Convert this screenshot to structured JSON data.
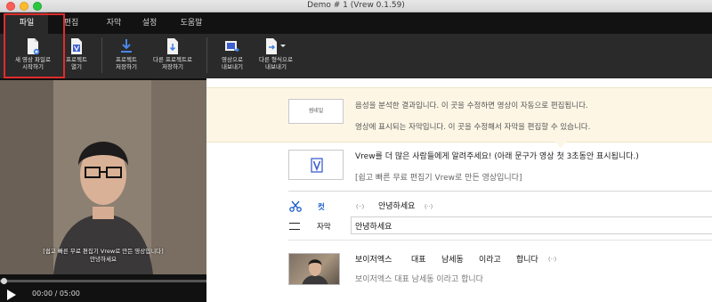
{
  "window": {
    "title": "Demo # 1 (Vrew 0.1.59)"
  },
  "menu": {
    "tabs": [
      {
        "label": "파일",
        "active": true
      },
      {
        "label": "편집",
        "active": false
      },
      {
        "label": "자막",
        "active": false
      },
      {
        "label": "설정",
        "active": false
      },
      {
        "label": "도움말",
        "active": false
      }
    ]
  },
  "toolbar": {
    "new_project": "새 영상 파일로\n시작하기",
    "open_project": "프로젝트\n열기",
    "save_project": "프로젝트\n저장하기",
    "save_as": "다른 프로젝트로\n저장하기",
    "export_video": "영상으로\n내보내기",
    "export_other": "다른 형식으로\n내보내기"
  },
  "player": {
    "subtitle_overlay_line1": "[쉽고 빠른 무료 편집기 Vrew로 만든 영상입니다]",
    "subtitle_overlay_line2": "안녕하세요",
    "time": "00:00 / 05:00",
    "progress": 0
  },
  "editor": {
    "info": {
      "thumb_label": "썸네일",
      "line1": "음성을 분석한 결과입니다. 이 곳을 수정하면 영상이 자동으로 편집됩니다.",
      "line2": "영상에 표시되는 자막입니다. 이 곳을 수정해서 자막을 편집할 수 있습니다."
    },
    "promo": {
      "line1": "Vrew를 더 많은 사람들에게 알려주세요! (아래 문구가 영상 첫 3초동안 표시됩니다.)",
      "line2": "[쉽고 빠른 무료 편집기 Vrew로 만든 영상입니다]"
    },
    "cut": {
      "label": "컷",
      "token_before": "(··)",
      "word": "안녕하세요",
      "token_after": "(··)"
    },
    "subtitle": {
      "label": "자막",
      "value": "안녕하세요"
    },
    "clip": {
      "words": [
        "보이저엑스",
        "대표",
        "남세동",
        "이라고",
        "합니다",
        "(··)"
      ],
      "subtitle": "보이저엑스 대표 남세동 이라고 합니다"
    }
  },
  "colors": {
    "highlight": "#e02c2c",
    "cut_label": "#1f5fcf",
    "info_bg": "#fdf6e5"
  }
}
